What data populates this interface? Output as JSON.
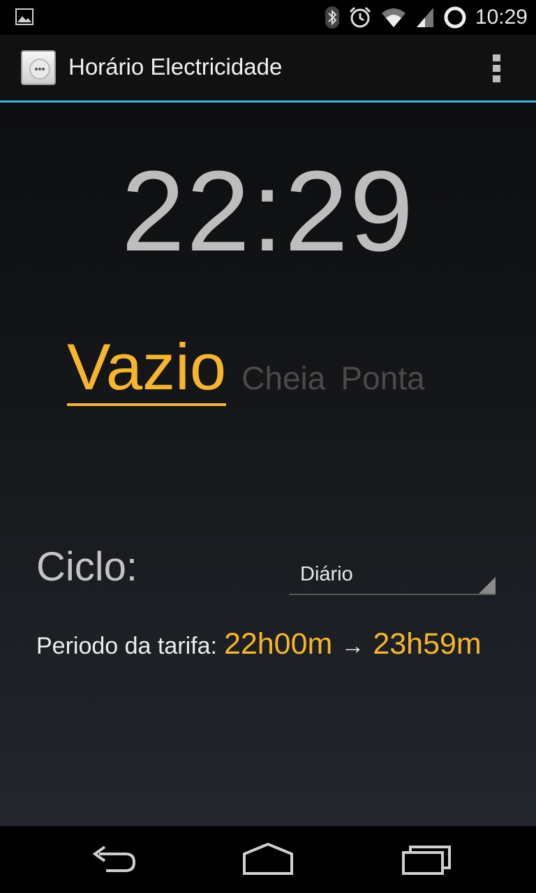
{
  "status_bar": {
    "time": "10:29",
    "icons": [
      "gallery-icon",
      "bluetooth-icon",
      "alarm-icon",
      "wifi-icon",
      "signal-icon",
      "sync-icon"
    ]
  },
  "action_bar": {
    "app_icon": "power-socket-icon",
    "title": "Horário Electricidade",
    "overflow_icon": "overflow-menu-icon"
  },
  "clock": {
    "time": "22:29"
  },
  "tariffs": {
    "active": "Vazio",
    "options": [
      "Cheia",
      "Ponta"
    ]
  },
  "cycle": {
    "label": "Ciclo:",
    "selected": "Diário"
  },
  "period": {
    "label": "Periodo da tarifa:",
    "start": "22h00m",
    "arrow": "→",
    "end": "23h59m"
  },
  "nav_bar": {
    "icons": [
      "back-icon",
      "home-icon",
      "recent-apps-icon"
    ]
  },
  "colors": {
    "accent": "#f7b52b",
    "holo_blue": "#33b5e5",
    "clock_text": "#bdbdbd",
    "inactive_text": "#4a4a4a"
  }
}
